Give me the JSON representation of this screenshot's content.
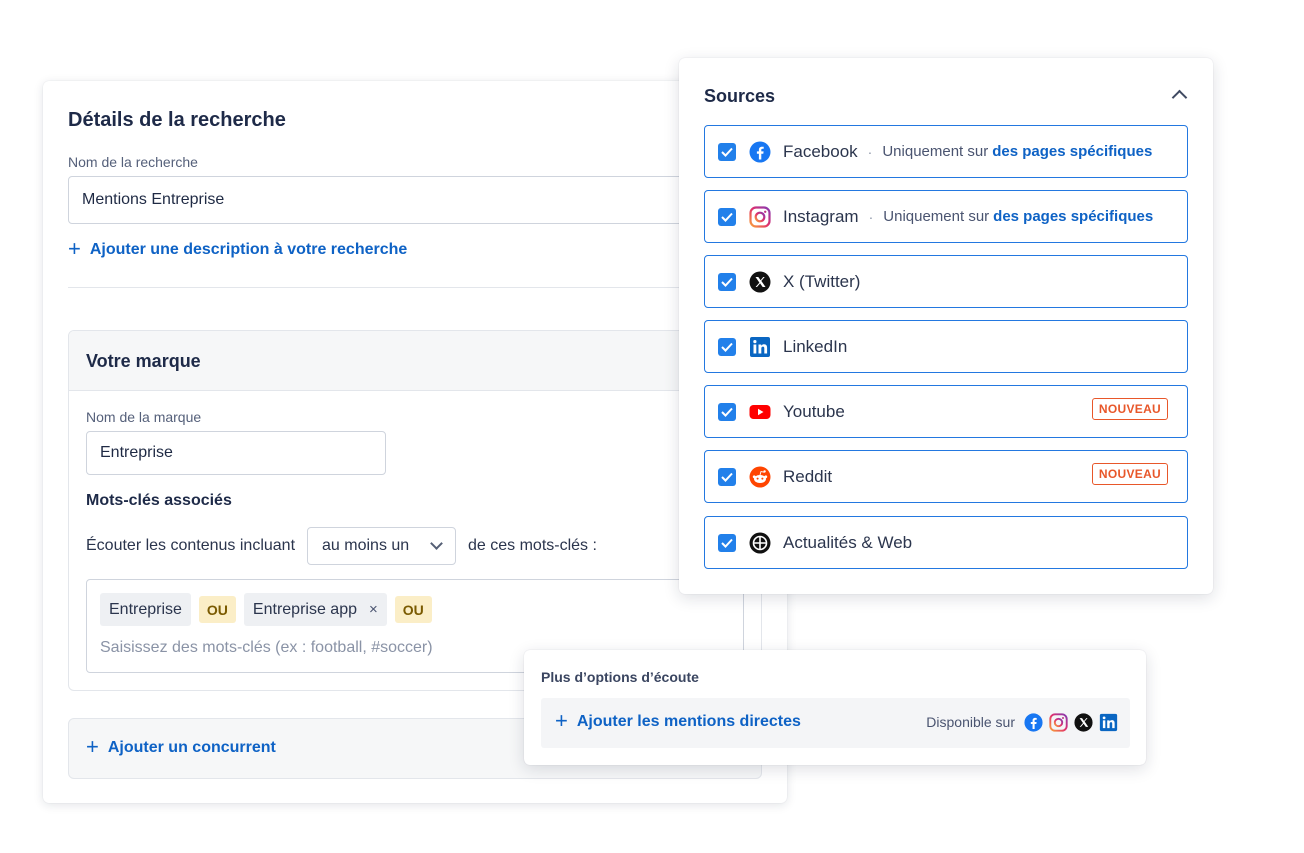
{
  "search_details": {
    "title": "Détails de la recherche",
    "name_label": "Nom de la recherche",
    "name_value": "Mentions Entreprise",
    "add_description": "Ajouter une description à votre recherche"
  },
  "brand": {
    "title": "Votre marque",
    "name_label": "Nom de la marque",
    "name_value": "Entreprise",
    "keywords_title": "Mots-clés associés",
    "listen_prefix": "Écouter les contenus incluant",
    "listen_select": "au moins un",
    "listen_suffix": "de ces mots-clés :",
    "chips": [
      "Entreprise",
      "Entreprise app"
    ],
    "or_label": "OU",
    "remove_glyph": "×",
    "keyword_placeholder": "Saisissez des mots-clés (ex : football, #soccer)"
  },
  "competitor": {
    "add_label": "Ajouter un concurrent"
  },
  "sources": {
    "title": "Sources",
    "items": [
      {
        "name": "Facebook",
        "icon": "facebook-icon",
        "note": "Uniquement sur",
        "note_link": "des pages spécifiques",
        "checked": true
      },
      {
        "name": "Instagram",
        "icon": "instagram-icon",
        "note": "Uniquement sur",
        "note_link": "des pages spécifiques",
        "checked": true
      },
      {
        "name": "X (Twitter)",
        "icon": "x-icon",
        "checked": true
      },
      {
        "name": "LinkedIn",
        "icon": "linkedin-icon",
        "checked": true
      },
      {
        "name": "Youtube",
        "icon": "youtube-icon",
        "badge": "NOUVEAU",
        "checked": true
      },
      {
        "name": "Reddit",
        "icon": "reddit-icon",
        "badge": "NOUVEAU",
        "checked": true
      },
      {
        "name": "Actualités & Web",
        "icon": "web-icon",
        "checked": true
      }
    ]
  },
  "more_options": {
    "title": "Plus d’options d’écoute",
    "add_direct": "Ajouter les mentions directes",
    "available_on": "Disponible sur"
  },
  "colors": {
    "accent": "#0e62c5",
    "checkbox": "#2280ea",
    "badge": "#e8572a",
    "or_chip_bg": "#fbeec7"
  }
}
